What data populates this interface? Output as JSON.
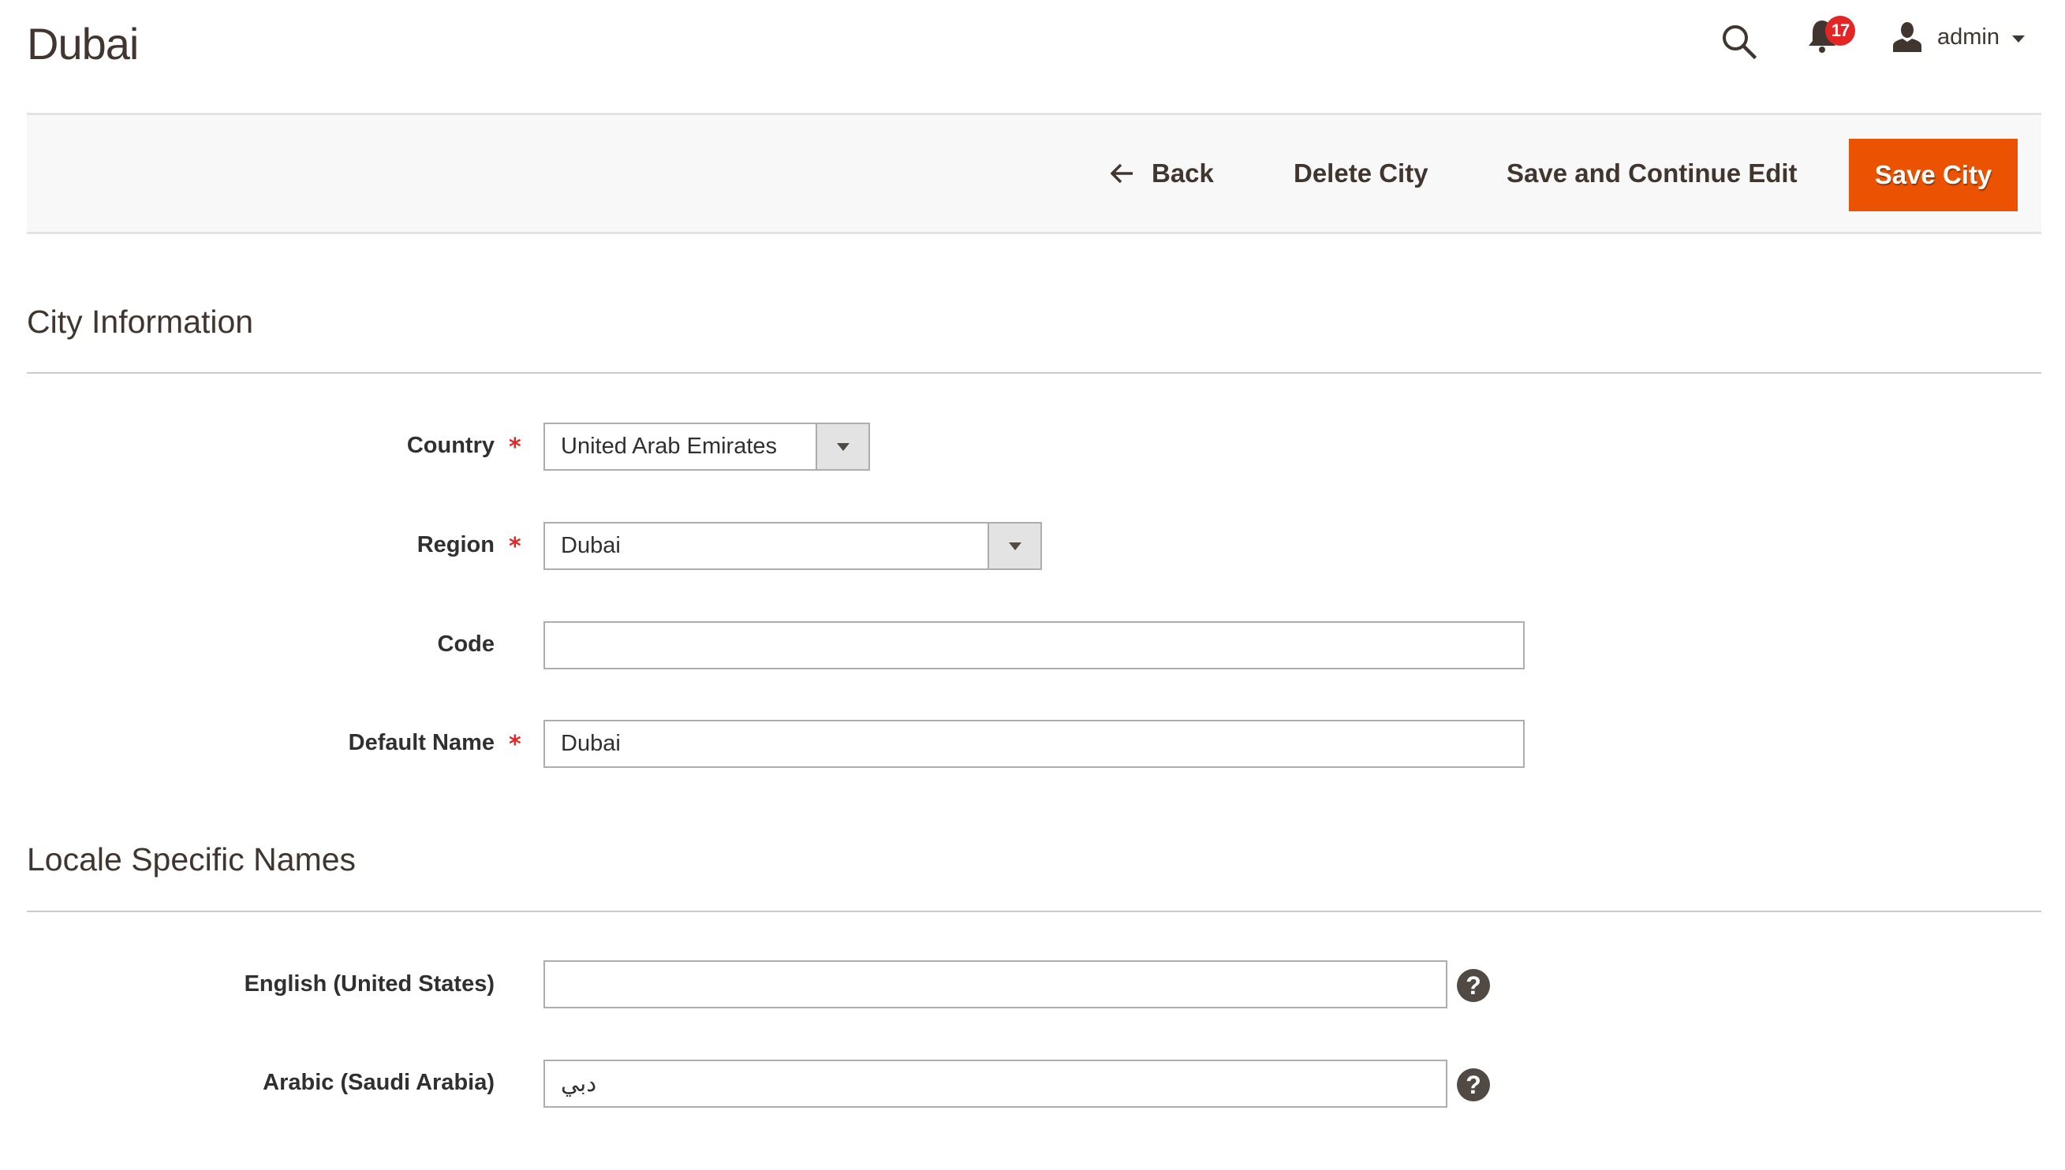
{
  "page": {
    "title": "Dubai"
  },
  "header": {
    "search_icon": "search-icon",
    "notifications": {
      "icon": "bell-icon",
      "count": "17",
      "badge_color": "#e22626"
    },
    "user": {
      "icon": "user-icon",
      "name": "admin",
      "caret_icon": "caret-down-icon"
    }
  },
  "actions": {
    "back_label": "Back",
    "back_icon": "arrow-left-icon",
    "delete_label": "Delete City",
    "save_continue_label": "Save and Continue Edit",
    "save_label": "Save City",
    "primary_color": "#eb5202"
  },
  "sections": {
    "city_info": {
      "title": "City Information",
      "fields": {
        "country": {
          "label": "Country",
          "required": "*",
          "value": "United Arab Emirates"
        },
        "region": {
          "label": "Region",
          "required": "*",
          "value": "Dubai"
        },
        "code": {
          "label": "Code",
          "value": ""
        },
        "default_name": {
          "label": "Default Name",
          "required": "*",
          "value": "Dubai"
        }
      }
    },
    "locale_names": {
      "title": "Locale Specific Names",
      "fields": {
        "english": {
          "label": "English (United States)",
          "value": "",
          "help_icon": "?"
        },
        "arabic": {
          "label": "Arabic (Saudi Arabia)",
          "value": "دبي",
          "help_icon": "?"
        }
      }
    }
  }
}
